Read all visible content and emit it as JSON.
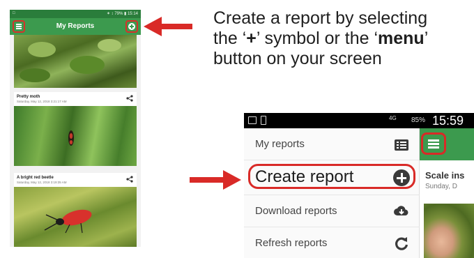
{
  "instruction": {
    "line1": "Create a report by selecting",
    "line2_pre": "the ‘",
    "line2_plus": "+",
    "line2_mid": "’ symbol or the ‘",
    "line2_menu": "menu",
    "line2_post": "’",
    "line3": "button on your screen"
  },
  "phone1": {
    "status_left": "□",
    "status_right": "✶ ↕ 79% ▮ 15:14",
    "title": "My Reports",
    "reports": [
      {
        "title": "Pretty moth",
        "date": "Saturday, May 12, 2018 3:21:17 AM"
      },
      {
        "title": "A bright red beetle",
        "date": "Saturday, May 12, 2018 3:19:35 AM"
      }
    ]
  },
  "phone2": {
    "status": {
      "network": "4G",
      "battery": "85%",
      "time": "15:59"
    },
    "drawer": {
      "items": [
        {
          "label": "My reports",
          "icon": "list-icon"
        },
        {
          "label": "Create report",
          "icon": "plus-circle-icon"
        },
        {
          "label": "Download reports",
          "icon": "cloud-download-icon"
        },
        {
          "label": "Refresh reports",
          "icon": "refresh-icon"
        }
      ]
    },
    "card": {
      "title": "Scale ins",
      "subtitle": "Sunday, D"
    }
  },
  "colors": {
    "accent_green": "#3c9a4e",
    "highlight_red": "#d92a27"
  }
}
